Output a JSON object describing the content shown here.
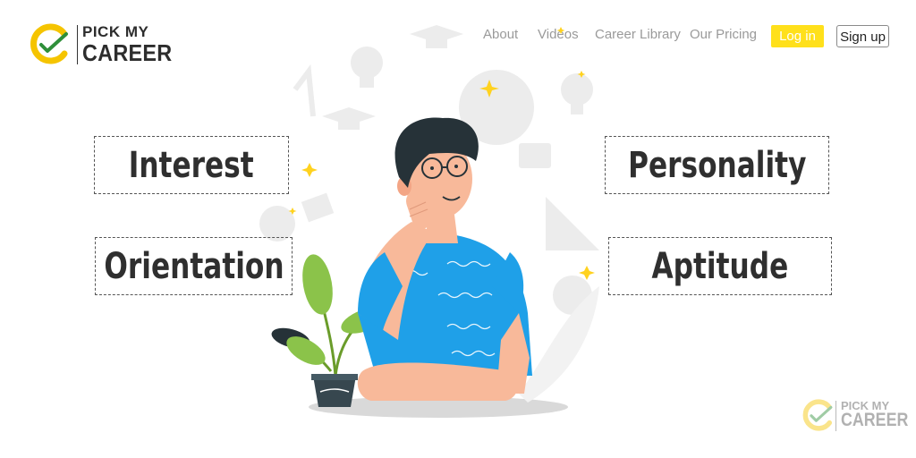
{
  "brand": {
    "name_top": "PICK MY",
    "name_bottom": "CAREER",
    "colors": {
      "ring": "#f5c400",
      "check": "#2f8f3a"
    }
  },
  "nav": {
    "about": "About",
    "videos": "Videos",
    "career_library": "Career Library",
    "pricing": "Our Pricing",
    "login": "Log in",
    "signup": "Sign up"
  },
  "labels": {
    "interest": "Interest",
    "orientation": "Orientation",
    "personality": "Personality",
    "aptitude": "Aptitude"
  },
  "watermark": {
    "name_top": "PICK MY",
    "name_bottom": "CAREER"
  },
  "colors": {
    "accent_yellow": "#ffe01b",
    "shirt_blue": "#1fa0e8",
    "skin": "#f8b99a",
    "hair": "#263238",
    "leaf_green": "#8bc34a"
  }
}
